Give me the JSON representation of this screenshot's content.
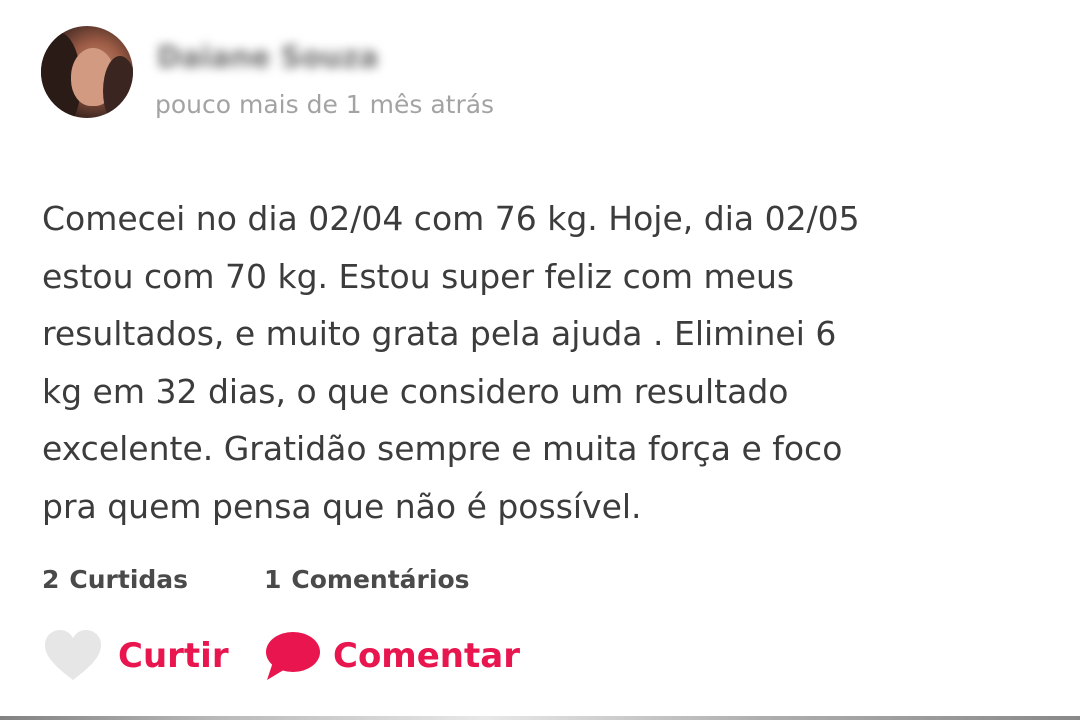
{
  "post": {
    "author_name": "Daiane Souza",
    "time": "pouco mais de 1 mês atrás",
    "lines": [
      "Comecei no dia 02/04 com 76 kg. Hoje, dia 02/05",
      "estou com 70 kg. Estou super feliz com meus",
      "resultados, e muito grata pela ajuda . Eliminei 6",
      "kg em 32 dias, o que considero um resultado",
      "excelente. Gratidão sempre e muita força e foco",
      "pra quem pensa que não é possível."
    ]
  },
  "stats": {
    "likes_count": "2",
    "likes_label": "Curtidas",
    "comments_count": "1",
    "comments_label": "Comentários"
  },
  "actions": {
    "like_label": "Curtir",
    "comment_label": "Comentar"
  },
  "icons": {
    "like": "heart-icon",
    "comment": "speech-bubble-icon"
  },
  "colors": {
    "accent": "#e8154f",
    "heart": "#e6e6e6",
    "time_text": "#a3a3a3",
    "body_text": "#3c3c3c"
  }
}
